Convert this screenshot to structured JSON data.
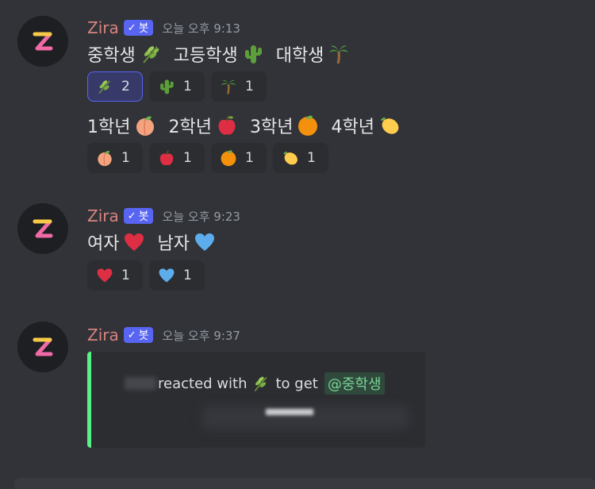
{
  "messages": [
    {
      "username": "Zira",
      "bot_tag": "봇",
      "timestamp": "오늘 오후 9:13",
      "lines": [
        [
          {
            "text": "중학생",
            "emoji": "herb"
          },
          {
            "text": "고등학생",
            "emoji": "cactus"
          },
          {
            "text": "대학생",
            "emoji": "palm-tree"
          }
        ],
        [
          {
            "text": "1학년",
            "emoji": "peach"
          },
          {
            "text": "2학년",
            "emoji": "apple"
          },
          {
            "text": "3학년",
            "emoji": "orange"
          },
          {
            "text": "4학년",
            "emoji": "lemon"
          }
        ]
      ],
      "reactions": [
        [
          {
            "emoji": "herb",
            "count": "2",
            "active": true
          },
          {
            "emoji": "cactus",
            "count": "1",
            "active": false
          },
          {
            "emoji": "palm-tree",
            "count": "1",
            "active": false
          }
        ],
        [
          {
            "emoji": "peach",
            "count": "1",
            "active": false
          },
          {
            "emoji": "apple",
            "count": "1",
            "active": false
          },
          {
            "emoji": "orange",
            "count": "1",
            "active": false
          },
          {
            "emoji": "lemon",
            "count": "1",
            "active": false
          }
        ]
      ]
    },
    {
      "username": "Zira",
      "bot_tag": "봇",
      "timestamp": "오늘 오후 9:23",
      "lines": [
        [
          {
            "text": "여자",
            "emoji": "red-heart"
          },
          {
            "text": "남자",
            "emoji": "blue-heart"
          }
        ]
      ],
      "reactions": [
        [
          {
            "emoji": "red-heart",
            "count": "1",
            "active": false
          },
          {
            "emoji": "blue-heart",
            "count": "1",
            "active": false
          }
        ]
      ]
    },
    {
      "username": "Zira",
      "bot_tag": "봇",
      "timestamp": "오늘 오후 9:37",
      "embed": {
        "reacted_text": "reacted with",
        "to_get_text": "to get",
        "mention": "@중학생"
      }
    }
  ],
  "colors": {
    "background": "#313338",
    "username": "#d8837e",
    "bot_tag": "#5865f2",
    "embed_border": "#57f287",
    "mention": "#7bd495"
  }
}
